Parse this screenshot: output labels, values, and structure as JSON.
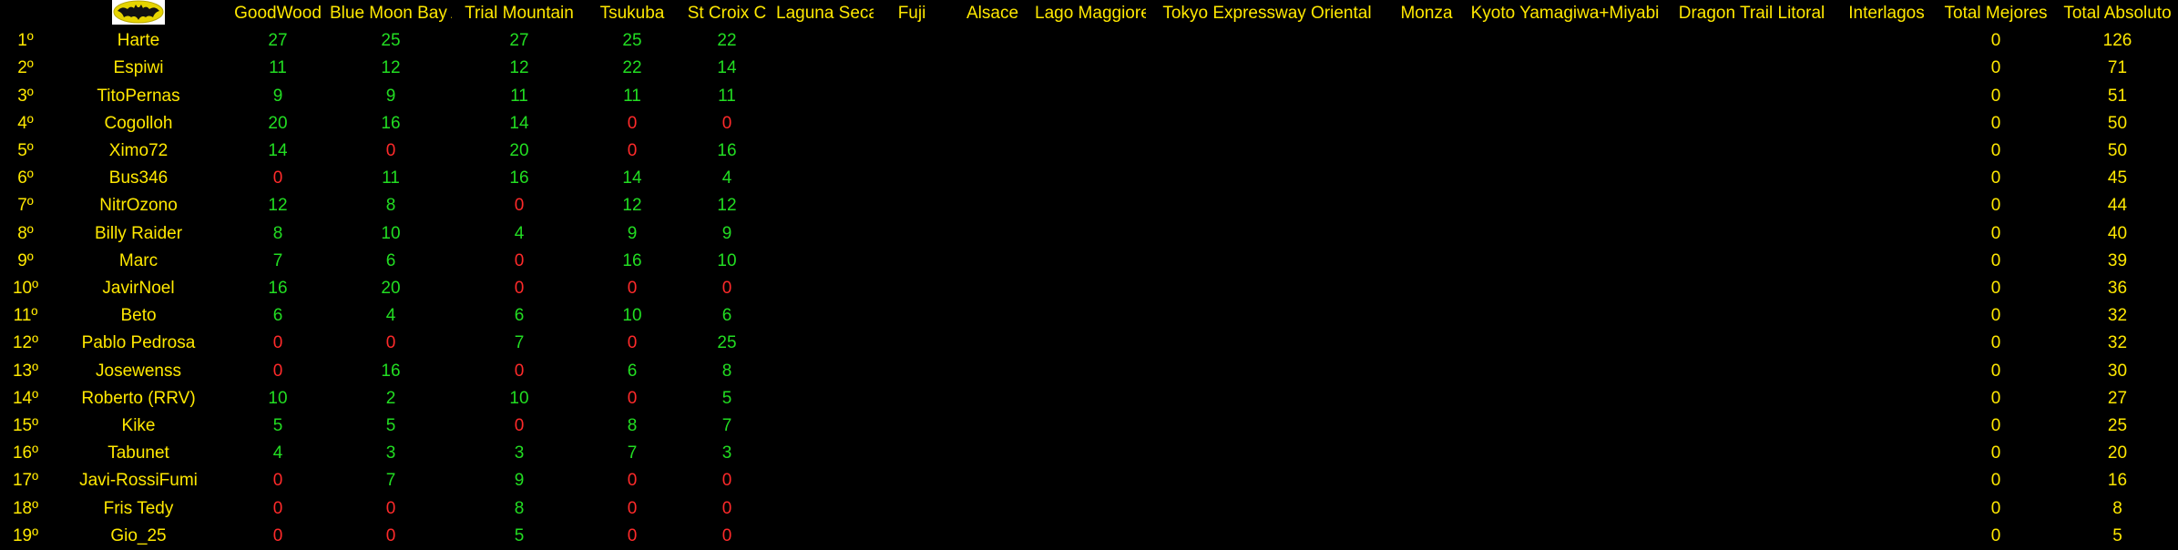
{
  "logo": {
    "icon": "bat-logo-icon",
    "colors": {
      "field": "#E6D400",
      "bat": "#111111"
    }
  },
  "colors": {
    "header": "#FFE800",
    "points": "#22DD22",
    "no_points": "#FF2A2A",
    "background": "#000000"
  },
  "columns": [
    "GoodWood",
    "Blue Moon Bay A",
    "Trial Mountain",
    "Tsukuba",
    "St Croix C",
    "Laguna Seca",
    "Fuji",
    "Alsace",
    "Lago Maggiore",
    "Tokyo Expressway Oriental",
    "Monza",
    "Kyoto Yamagiwa+Miyabi",
    "Dragon Trail Litoral",
    "Interlagos",
    "Total Mejores",
    "Total Absoluto"
  ],
  "rows": [
    {
      "pos": "1º",
      "name": "Harte",
      "scores": [
        "27",
        "25",
        "27",
        "25",
        "22",
        "",
        "",
        "",
        "",
        "",
        "",
        "",
        "",
        ""
      ],
      "mejores": "0",
      "absoluto": "126"
    },
    {
      "pos": "2º",
      "name": "Espiwi",
      "scores": [
        "11",
        "12",
        "12",
        "22",
        "14",
        "",
        "",
        "",
        "",
        "",
        "",
        "",
        "",
        ""
      ],
      "mejores": "0",
      "absoluto": "71"
    },
    {
      "pos": "3º",
      "name": "TitoPernas",
      "scores": [
        "9",
        "9",
        "11",
        "11",
        "11",
        "",
        "",
        "",
        "",
        "",
        "",
        "",
        "",
        ""
      ],
      "mejores": "0",
      "absoluto": "51"
    },
    {
      "pos": "4º",
      "name": "Cogolloh",
      "scores": [
        "20",
        "16",
        "14",
        "0",
        "0",
        "",
        "",
        "",
        "",
        "",
        "",
        "",
        "",
        ""
      ],
      "mejores": "0",
      "absoluto": "50"
    },
    {
      "pos": "5º",
      "name": "Ximo72",
      "scores": [
        "14",
        "0",
        "20",
        "0",
        "16",
        "",
        "",
        "",
        "",
        "",
        "",
        "",
        "",
        ""
      ],
      "mejores": "0",
      "absoluto": "50"
    },
    {
      "pos": "6º",
      "name": "Bus346",
      "scores": [
        "0",
        "11",
        "16",
        "14",
        "4",
        "",
        "",
        "",
        "",
        "",
        "",
        "",
        "",
        ""
      ],
      "mejores": "0",
      "absoluto": "45"
    },
    {
      "pos": "7º",
      "name": "NitrOzono",
      "scores": [
        "12",
        "8",
        "0",
        "12",
        "12",
        "",
        "",
        "",
        "",
        "",
        "",
        "",
        "",
        ""
      ],
      "mejores": "0",
      "absoluto": "44"
    },
    {
      "pos": "8º",
      "name": "Billy Raider",
      "scores": [
        "8",
        "10",
        "4",
        "9",
        "9",
        "",
        "",
        "",
        "",
        "",
        "",
        "",
        "",
        ""
      ],
      "mejores": "0",
      "absoluto": "40"
    },
    {
      "pos": "9º",
      "name": "Marc",
      "scores": [
        "7",
        "6",
        "0",
        "16",
        "10",
        "",
        "",
        "",
        "",
        "",
        "",
        "",
        "",
        ""
      ],
      "mejores": "0",
      "absoluto": "39"
    },
    {
      "pos": "10º",
      "name": "JavirNoel",
      "scores": [
        "16",
        "20",
        "0",
        "0",
        "0",
        "",
        "",
        "",
        "",
        "",
        "",
        "",
        "",
        ""
      ],
      "mejores": "0",
      "absoluto": "36"
    },
    {
      "pos": "11º",
      "name": "Beto",
      "scores": [
        "6",
        "4",
        "6",
        "10",
        "6",
        "",
        "",
        "",
        "",
        "",
        "",
        "",
        "",
        ""
      ],
      "mejores": "0",
      "absoluto": "32"
    },
    {
      "pos": "12º",
      "name": "Pablo Pedrosa",
      "scores": [
        "0",
        "0",
        "7",
        "0",
        "25",
        "",
        "",
        "",
        "",
        "",
        "",
        "",
        "",
        ""
      ],
      "mejores": "0",
      "absoluto": "32"
    },
    {
      "pos": "13º",
      "name": "Josewenss",
      "scores": [
        "0",
        "16",
        "0",
        "6",
        "8",
        "",
        "",
        "",
        "",
        "",
        "",
        "",
        "",
        ""
      ],
      "mejores": "0",
      "absoluto": "30"
    },
    {
      "pos": "14º",
      "name": "Roberto (RRV)",
      "scores": [
        "10",
        "2",
        "10",
        "0",
        "5",
        "",
        "",
        "",
        "",
        "",
        "",
        "",
        "",
        ""
      ],
      "mejores": "0",
      "absoluto": "27"
    },
    {
      "pos": "15º",
      "name": "Kike",
      "scores": [
        "5",
        "5",
        "0",
        "8",
        "7",
        "",
        "",
        "",
        "",
        "",
        "",
        "",
        "",
        ""
      ],
      "mejores": "0",
      "absoluto": "25"
    },
    {
      "pos": "16º",
      "name": "Tabunet",
      "scores": [
        "4",
        "3",
        "3",
        "7",
        "3",
        "",
        "",
        "",
        "",
        "",
        "",
        "",
        "",
        ""
      ],
      "mejores": "0",
      "absoluto": "20"
    },
    {
      "pos": "17º",
      "name": "Javi-RossiFumi",
      "scores": [
        "0",
        "7",
        "9",
        "0",
        "0",
        "",
        "",
        "",
        "",
        "",
        "",
        "",
        "",
        ""
      ],
      "mejores": "0",
      "absoluto": "16"
    },
    {
      "pos": "18º",
      "name": "Fris Tedy",
      "scores": [
        "0",
        "0",
        "8",
        "0",
        "0",
        "",
        "",
        "",
        "",
        "",
        "",
        "",
        "",
        ""
      ],
      "mejores": "0",
      "absoluto": "8"
    },
    {
      "pos": "19º",
      "name": "Gio_25",
      "scores": [
        "0",
        "0",
        "5",
        "0",
        "0",
        "",
        "",
        "",
        "",
        "",
        "",
        "",
        "",
        ""
      ],
      "mejores": "0",
      "absoluto": "5"
    }
  ]
}
